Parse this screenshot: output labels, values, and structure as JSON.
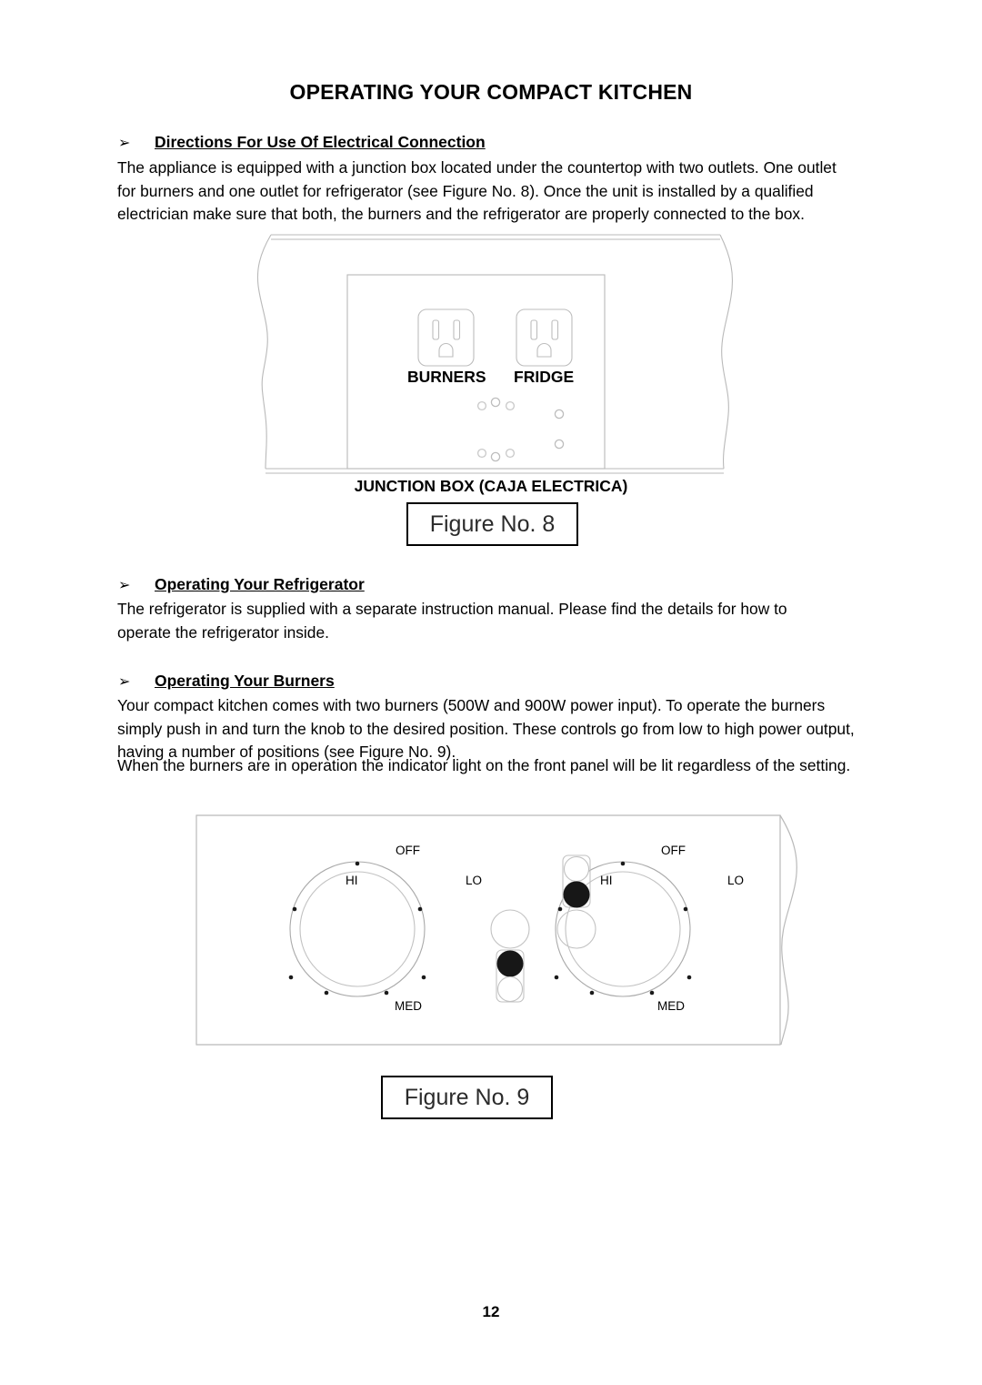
{
  "document": {
    "title": "OPERATING YOUR COMPACT KITCHEN",
    "page_number": "12",
    "bullet_glyph": "➢"
  },
  "sections": [
    {
      "heading": "Directions For Use Of Electrical Connection",
      "body": "The appliance is equipped with a junction box located under the countertop with two outlets. One outlet for burners and one outlet for refrigerator (see Figure No. 8).  Once the unit is installed by a qualified electrician make sure that both, the burners and the refrigerator are properly connected to the box."
    },
    {
      "heading": "Operating Your Refrigerator",
      "body": "The refrigerator is supplied with a separate instruction manual. Please find the details for how to operate the refrigerator inside."
    },
    {
      "heading": "Operating Your Burners",
      "body": "Your compact kitchen comes with two burners (500W and 900W power input). To operate the burners simply push in and turn the knob to the desired position. These controls go from low to high power output, having a number of positions (see Figure No. 9).",
      "body2": "When the burners are in operation the indicator light on the front panel will be lit regardless of the setting."
    }
  ],
  "figure8": {
    "caption": "JUNCTION BOX (CAJA ELECTRICA)",
    "label": "Figure No. 8",
    "outlets": [
      {
        "name": "BURNERS"
      },
      {
        "name": "FRIDGE"
      }
    ]
  },
  "figure9": {
    "label": "Figure No. 9",
    "knobs": [
      {
        "id": "left-burner-knob",
        "positions": [
          "OFF",
          "LO",
          "MED",
          "HI"
        ],
        "tick_count": 7
      },
      {
        "id": "right-burner-knob",
        "positions": [
          "OFF",
          "LO",
          "MED",
          "HI"
        ],
        "tick_count": 7
      }
    ],
    "indicator_lights": [
      {
        "id": "upper-indicator",
        "state": "lit"
      },
      {
        "id": "lower-indicator",
        "state": "lit"
      }
    ]
  },
  "colors": {
    "ink": "#000000",
    "line": "#b8b8b8",
    "line_dark": "#9a9a9a",
    "indicator_on": "#171717",
    "hole": "#c9c9c9"
  }
}
